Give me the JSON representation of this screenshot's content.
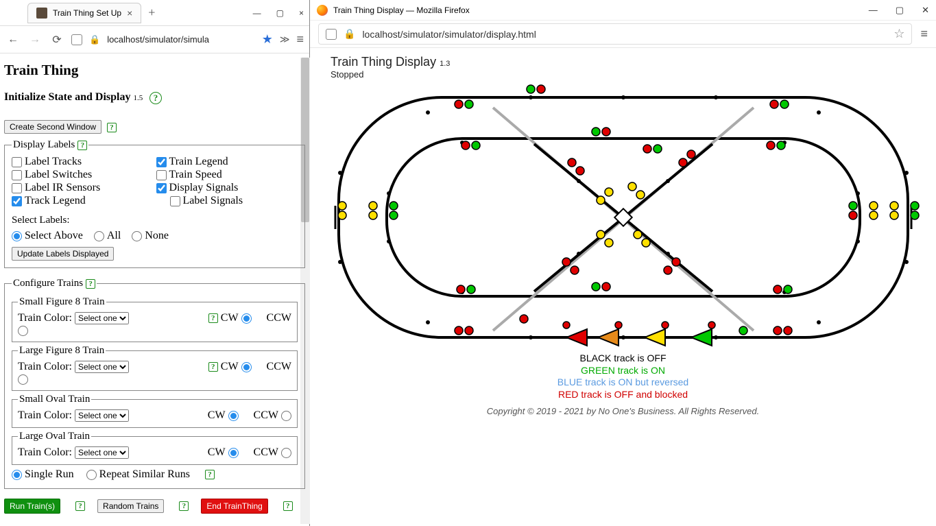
{
  "left": {
    "tab_title": "Train Thing Set Up",
    "url": "localhost/simulator/simula",
    "page_title": "Train Thing",
    "section_title": "Initialize State and Display",
    "section_ver": "1.5",
    "create_window_btn": "Create Second Window",
    "display_labels": {
      "title": "Display Labels",
      "label_tracks": "Label Tracks",
      "label_switches": "Label Switches",
      "label_ir": "Label IR Sensors",
      "track_legend": "Track Legend",
      "train_legend": "Train Legend",
      "train_speed": "Train Speed",
      "display_signals": "Display Signals",
      "label_signals": "Label Signals"
    },
    "select_labels": {
      "title": "Select Labels:",
      "above": "Select Above",
      "all": "All",
      "none": "None",
      "update_btn": "Update Labels Displayed"
    },
    "configure_trains": {
      "title": "Configure Trains",
      "train_color_label": "Train Color:",
      "select_placeholder": "Select one",
      "cw": "CW",
      "ccw": "CCW",
      "trains": [
        {
          "name": "Small Figure 8 Train"
        },
        {
          "name": "Large Figure 8 Train"
        },
        {
          "name": "Small Oval Train"
        },
        {
          "name": "Large Oval Train"
        }
      ],
      "single_run": "Single Run",
      "repeat_runs": "Repeat Similar Runs"
    },
    "buttons": {
      "run": "Run Train(s)",
      "random": "Random Trains",
      "end": "End TrainThing"
    }
  },
  "right": {
    "window_title": "Train Thing Display — Mozilla Firefox",
    "url": "localhost/simulator/simulator/display.html",
    "title": "Train Thing Display",
    "ver": "1.3",
    "status": "Stopped",
    "legend": {
      "black": "BLACK track is OFF",
      "green": "GREEN track is ON",
      "blue": "BLUE track is ON but reversed",
      "red": "RED track is OFF and blocked"
    },
    "copyright": "Copyright © 2019 - 2021 by No One's Business. All Rights Reserved."
  }
}
